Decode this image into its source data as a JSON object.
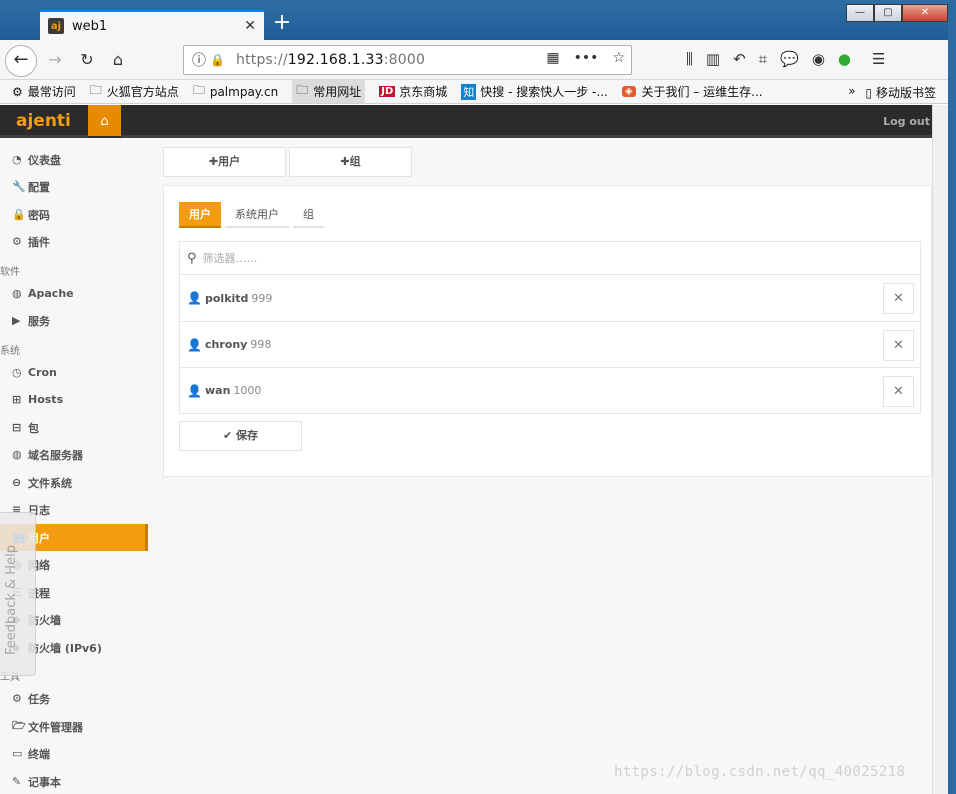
{
  "browser": {
    "tab_title": "web1",
    "tab_favicon": "aj",
    "new_tab": "+",
    "url_prefix": "https://",
    "url_host": "192.168.1.33",
    "url_port": ":8000",
    "overflow": "•••",
    "bookmarks": [
      {
        "label": "最常访问",
        "icon": "gear-icon"
      },
      {
        "label": "火狐官方站点",
        "icon": "folder-icon"
      },
      {
        "label": "palmpay.cn",
        "icon": "folder-icon"
      },
      {
        "label": "常用网址",
        "icon": "folder-icon"
      },
      {
        "label": "京东商城",
        "badge": "JD"
      },
      {
        "label": "快搜 - 搜索快人一步 -...",
        "badge": "知"
      },
      {
        "label": "关于我们 – 运维生存...",
        "badge": "◈"
      }
    ],
    "more_bookmarks": "»",
    "mobile_bookmarks": "移动版书签"
  },
  "app": {
    "brand": "ajenti",
    "logout": "Log out",
    "sidebar": {
      "items": [
        {
          "label": "仪表盘",
          "icon": "dashboard-icon"
        },
        {
          "label": "配置",
          "icon": "wrench-icon"
        },
        {
          "label": "密码",
          "icon": "lock-icon"
        },
        {
          "label": "插件",
          "icon": "cogs-icon"
        }
      ],
      "cat_software": "软件",
      "software": [
        {
          "label": "Apache",
          "icon": "globe-icon"
        },
        {
          "label": "服务",
          "icon": "play-icon"
        }
      ],
      "cat_system": "系统",
      "system": [
        {
          "label": "Cron",
          "icon": "clock-icon"
        },
        {
          "label": "Hosts",
          "icon": "sitemap-icon"
        },
        {
          "label": "包",
          "icon": "gift-icon"
        },
        {
          "label": "域名服务器",
          "icon": "globe-icon"
        },
        {
          "label": "文件系统",
          "icon": "hdd-icon"
        },
        {
          "label": "日志",
          "icon": "list-icon"
        },
        {
          "label": "用户",
          "icon": "group-icon"
        },
        {
          "label": "网络",
          "icon": "globe-icon"
        },
        {
          "label": "进程",
          "icon": "tasks-icon"
        },
        {
          "label": "防火墙",
          "icon": "shield-icon"
        },
        {
          "label": "防火墙 (IPv6)",
          "icon": "shield-icon"
        }
      ],
      "cat_tools": "工具",
      "tools": [
        {
          "label": "任务",
          "icon": "gear-icon"
        },
        {
          "label": "文件管理器",
          "icon": "folder-open-icon"
        },
        {
          "label": "终端",
          "icon": "terminal-icon"
        },
        {
          "label": "记事本",
          "icon": "edit-icon"
        }
      ]
    },
    "feedback": "Feedback & Help",
    "actions": {
      "add_user": "用户",
      "add_group": "组"
    },
    "tabs": [
      "用户",
      "系统用户",
      "组"
    ],
    "filter_placeholder": "筛选器……",
    "users": [
      {
        "name": "polkitd",
        "uid": "999"
      },
      {
        "name": "chrony",
        "uid": "998"
      },
      {
        "name": "wan",
        "uid": "1000"
      }
    ],
    "save": "保存"
  },
  "watermark": "https://blog.csdn.net/qq_40025218"
}
